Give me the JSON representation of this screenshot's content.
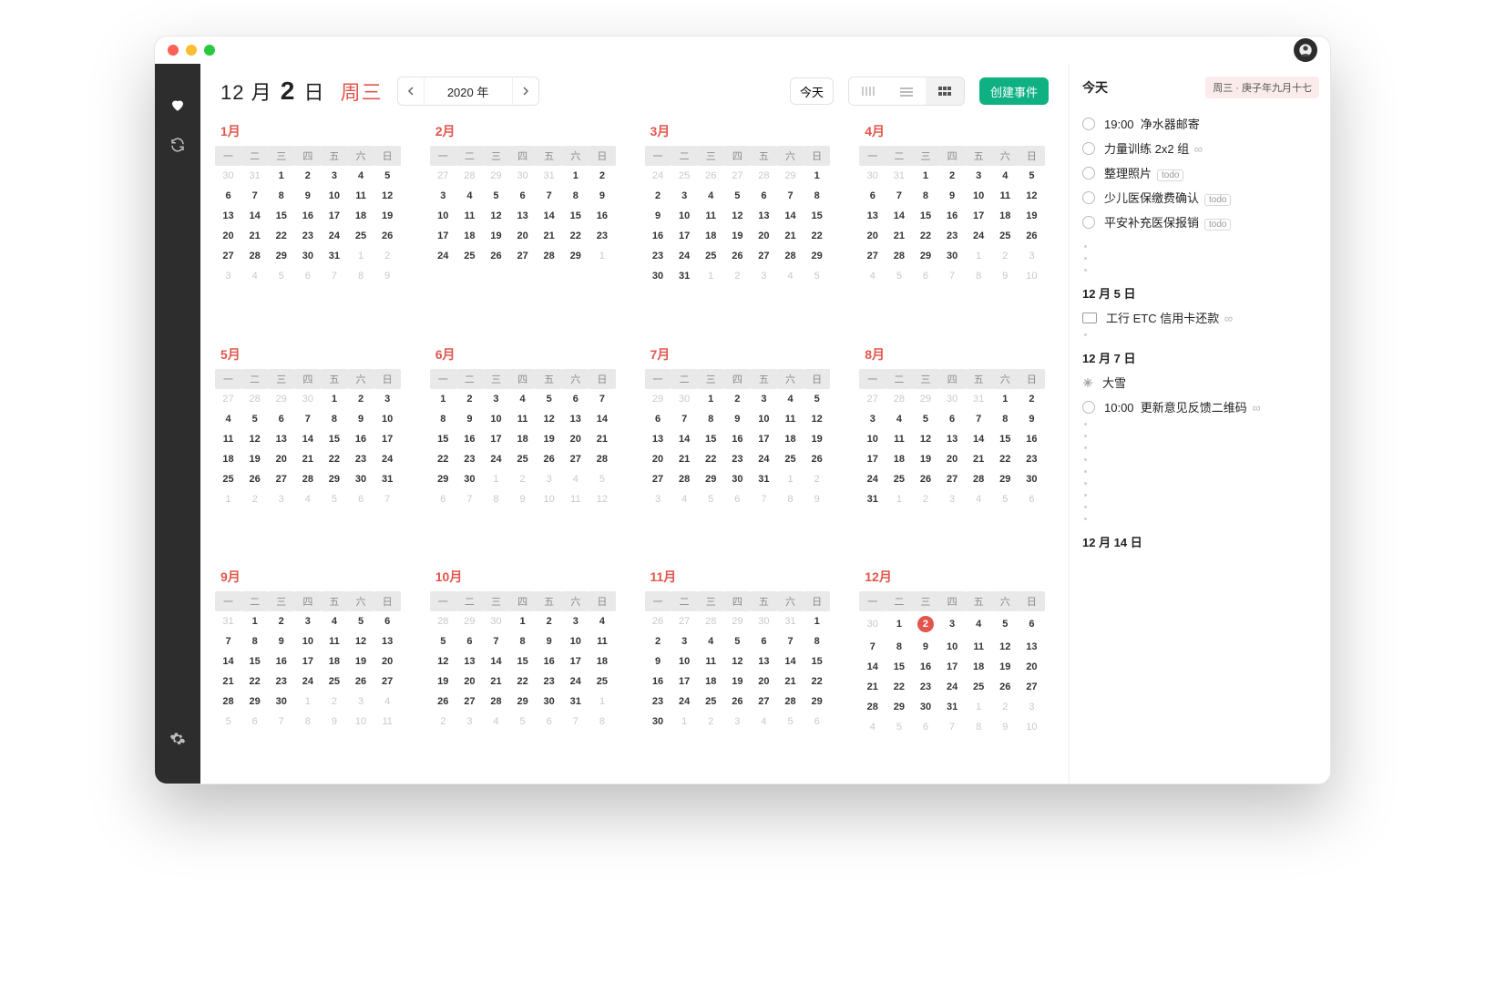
{
  "header": {
    "month_prefix": "12",
    "month_unit": "月",
    "day": "2",
    "day_unit": "日",
    "dow": "周三",
    "year_label": "2020 年",
    "today_btn": "今天",
    "create_btn": "创建事件"
  },
  "weekdays": [
    "一",
    "二",
    "三",
    "四",
    "五",
    "六",
    "日"
  ],
  "month_names": [
    "1月",
    "2月",
    "3月",
    "4月",
    "5月",
    "6月",
    "7月",
    "8月",
    "9月",
    "10月",
    "11月",
    "12月"
  ],
  "months": [
    {
      "lead_out": [
        30,
        31
      ],
      "days": 31,
      "trail": [
        1,
        2,
        3,
        4,
        5,
        6,
        7,
        8,
        9
      ]
    },
    {
      "lead_out": [
        27,
        28,
        29,
        30,
        31
      ],
      "days": 29,
      "trail": [
        1
      ]
    },
    {
      "lead_out": [
        24,
        25,
        26,
        27,
        28,
        29
      ],
      "days": 31,
      "trail": [
        1,
        2,
        3,
        4,
        5
      ]
    },
    {
      "lead_out": [
        30,
        31
      ],
      "days": 30,
      "trail": [
        1,
        2,
        3,
        4,
        5,
        6,
        7,
        8,
        9,
        10
      ]
    },
    {
      "lead_out": [
        27,
        28,
        29,
        30
      ],
      "days": 31,
      "trail": [
        1,
        2,
        3,
        4,
        5,
        6,
        7
      ]
    },
    {
      "lead_out": [],
      "days": 30,
      "trail": [
        1,
        2,
        3,
        4,
        5,
        6,
        7,
        8,
        9,
        10,
        11,
        12
      ]
    },
    {
      "lead_out": [
        29,
        30
      ],
      "days": 31,
      "trail": [
        1,
        2,
        3,
        4,
        5,
        6,
        7,
        8,
        9
      ]
    },
    {
      "lead_out": [
        27,
        28,
        29,
        30,
        31
      ],
      "days": 31,
      "trail": [
        1,
        2,
        3,
        4,
        5,
        6
      ]
    },
    {
      "lead_out": [
        31
      ],
      "days": 30,
      "trail": [
        1,
        2,
        3,
        4,
        5,
        6,
        7,
        8,
        9,
        10,
        11
      ]
    },
    {
      "lead_out": [
        28,
        29,
        30
      ],
      "days": 31,
      "trail": [
        1,
        2,
        3,
        4,
        5,
        6,
        7,
        8
      ]
    },
    {
      "lead_out": [
        26,
        27,
        28,
        29,
        30,
        31
      ],
      "days": 30,
      "trail": [
        1,
        2,
        3,
        4,
        5,
        6
      ]
    },
    {
      "lead_out": [
        30
      ],
      "days": 31,
      "trail": [
        1,
        2,
        3,
        4,
        5,
        6,
        7,
        8,
        9,
        10
      ]
    }
  ],
  "today_cell": {
    "month_index": 11,
    "day": 2
  },
  "sidebar": {
    "today_label": "今天",
    "lunar": "周三 · 庚子年九月十七",
    "today_events": [
      {
        "icon": "circle",
        "time": "19:00",
        "text": "净水器邮寄"
      },
      {
        "icon": "circle",
        "text": "力量训练 2x2 组",
        "repeat": true
      },
      {
        "icon": "circle",
        "text": "整理照片",
        "todo": true
      },
      {
        "icon": "circle",
        "text": "少儿医保缴费确认",
        "todo": true
      },
      {
        "icon": "circle",
        "text": "平安补充医保报销",
        "todo": true
      }
    ],
    "sections": [
      {
        "label": "12 月 5 日",
        "dots_before": 3,
        "dots_after": 1,
        "events": [
          {
            "icon": "card",
            "text": "工行 ETC 信用卡还款",
            "repeat": true
          }
        ]
      },
      {
        "label": "12 月 7 日",
        "dots_before": 0,
        "dots_after": 9,
        "events": [
          {
            "icon": "snow",
            "text": "大雪"
          },
          {
            "icon": "circle",
            "time": "10:00",
            "text": "更新意见反馈二维码",
            "repeat": true
          }
        ]
      },
      {
        "label": "12 月 14 日",
        "dots_before": 0,
        "dots_after": 0,
        "events": []
      }
    ]
  }
}
